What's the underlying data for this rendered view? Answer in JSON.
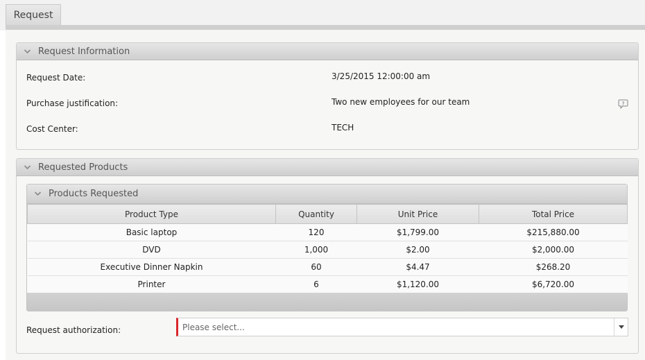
{
  "tab": {
    "label": "Request"
  },
  "request_info": {
    "title": "Request Information",
    "fields": [
      {
        "label": "Request Date:",
        "value": "3/25/2015 12:00:00 am"
      },
      {
        "label": "Purchase justification:",
        "value": "Two new employees for our team"
      },
      {
        "label": "Cost Center:",
        "value": "TECH"
      }
    ]
  },
  "requested_products": {
    "title": "Requested Products",
    "grid": {
      "title": "Products Requested",
      "columns": [
        "Product Type",
        "Quantity",
        "Unit Price",
        "Total Price"
      ],
      "rows": [
        [
          "Basic laptop",
          "120",
          "$1,799.00",
          "$215,880.00"
        ],
        [
          "DVD",
          "1,000",
          "$2.00",
          "$2,000.00"
        ],
        [
          "Executive Dinner Napkin",
          "60",
          "$4.47",
          "$268.20"
        ],
        [
          "Printer",
          "6",
          "$1,120.00",
          "$6,720.00"
        ]
      ]
    },
    "authorization": {
      "label": "Request authorization:",
      "placeholder": "Please select..."
    }
  },
  "icons": {
    "collapse": "chevron-down-icon",
    "help": "comment-help-icon",
    "dropdown": "caret-down-icon"
  },
  "colors": {
    "required_marker": "#d9262c"
  }
}
